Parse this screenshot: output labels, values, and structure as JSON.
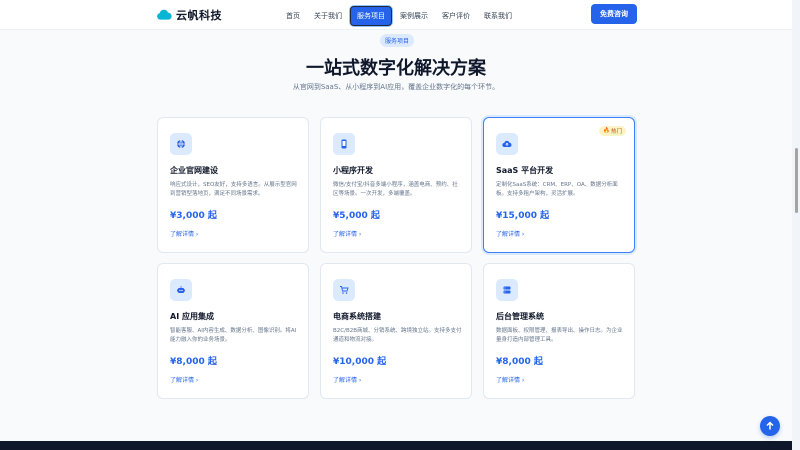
{
  "brand": {
    "name": "云帆科技",
    "color": "#2563eb"
  },
  "nav": {
    "items": [
      {
        "label": "首页",
        "active": false
      },
      {
        "label": "关于我们",
        "active": false
      },
      {
        "label": "服务项目",
        "active": true
      },
      {
        "label": "案例展示",
        "active": false
      },
      {
        "label": "客户评价",
        "active": false
      },
      {
        "label": "联系我们",
        "active": false
      }
    ],
    "cta_label": "免费咨询"
  },
  "hero": {
    "badge": "服务项目",
    "title": "一站式数字化解决方案",
    "subtitle": "从官网到SaaS、从小程序到AI应用，覆盖企业数字化的每个环节。"
  },
  "cards": [
    {
      "icon": "globe-icon",
      "title": "企业官网建设",
      "desc": "响应式设计，SEO友好，支持多语言。从展示型官网到营销型落地页，满足不同场景需求。",
      "price": "¥3,000 起",
      "link": "了解详情 ›",
      "hot": false
    },
    {
      "icon": "phone-icon",
      "title": "小程序开发",
      "desc": "微信/支付宝/抖音多端小程序，涵盖电商、预约、社区等场景。一次开发，多端覆盖。",
      "price": "¥5,000 起",
      "link": "了解详情 ›",
      "hot": false
    },
    {
      "icon": "cloud-upload-icon",
      "title": "SaaS 平台开发",
      "desc": "定制化SaaS系统：CRM、ERP、OA、数据分析面板。支持多租户架构，灵活扩展。",
      "price": "¥15,000 起",
      "link": "了解详情 ›",
      "hot": true,
      "hot_label": "热门"
    },
    {
      "icon": "robot-icon",
      "title": "AI 应用集成",
      "desc": "智能客服、AI内容生成、数据分析、图像识别。将AI能力融入你的业务场景。",
      "price": "¥8,000 起",
      "link": "了解详情 ›",
      "hot": false
    },
    {
      "icon": "cart-icon",
      "title": "电商系统搭建",
      "desc": "B2C/B2B商城、分销系统、跨境独立站。支持多支付通道和物流对接。",
      "price": "¥10,000 起",
      "link": "了解详情 ›",
      "hot": false
    },
    {
      "icon": "server-icon",
      "title": "后台管理系统",
      "desc": "数据面板、权限管理、报表导出、操作日志。为企业量身打造内部管理工具。",
      "price": "¥8,000 起",
      "link": "了解详情 ›",
      "hot": false
    }
  ]
}
